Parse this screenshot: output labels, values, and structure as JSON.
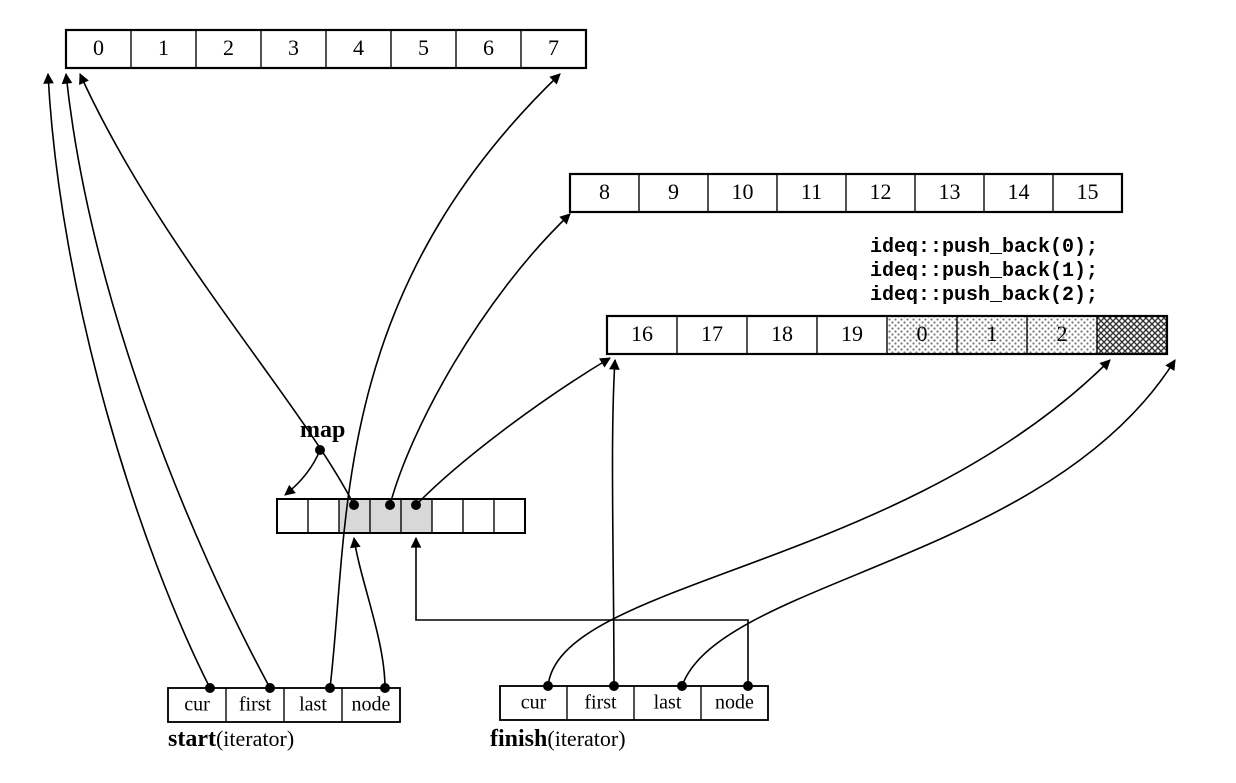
{
  "buffers": {
    "buf1": [
      "0",
      "1",
      "2",
      "3",
      "4",
      "5",
      "6",
      "7"
    ],
    "buf2": [
      "8",
      "9",
      "10",
      "11",
      "12",
      "13",
      "14",
      "15"
    ],
    "buf3": [
      "16",
      "17",
      "18",
      "19",
      "0",
      "1",
      "2",
      ""
    ]
  },
  "mapLabel": "map",
  "code": [
    "ideq::push_back(0);",
    "ideq::push_back(1);",
    "ideq::push_back(2);"
  ],
  "iterators": {
    "fields": [
      "cur",
      "first",
      "last",
      "node"
    ],
    "start": {
      "name": "start",
      "suffix": "(iterator)"
    },
    "finish": {
      "name": "finish",
      "suffix": "(iterator)"
    }
  }
}
